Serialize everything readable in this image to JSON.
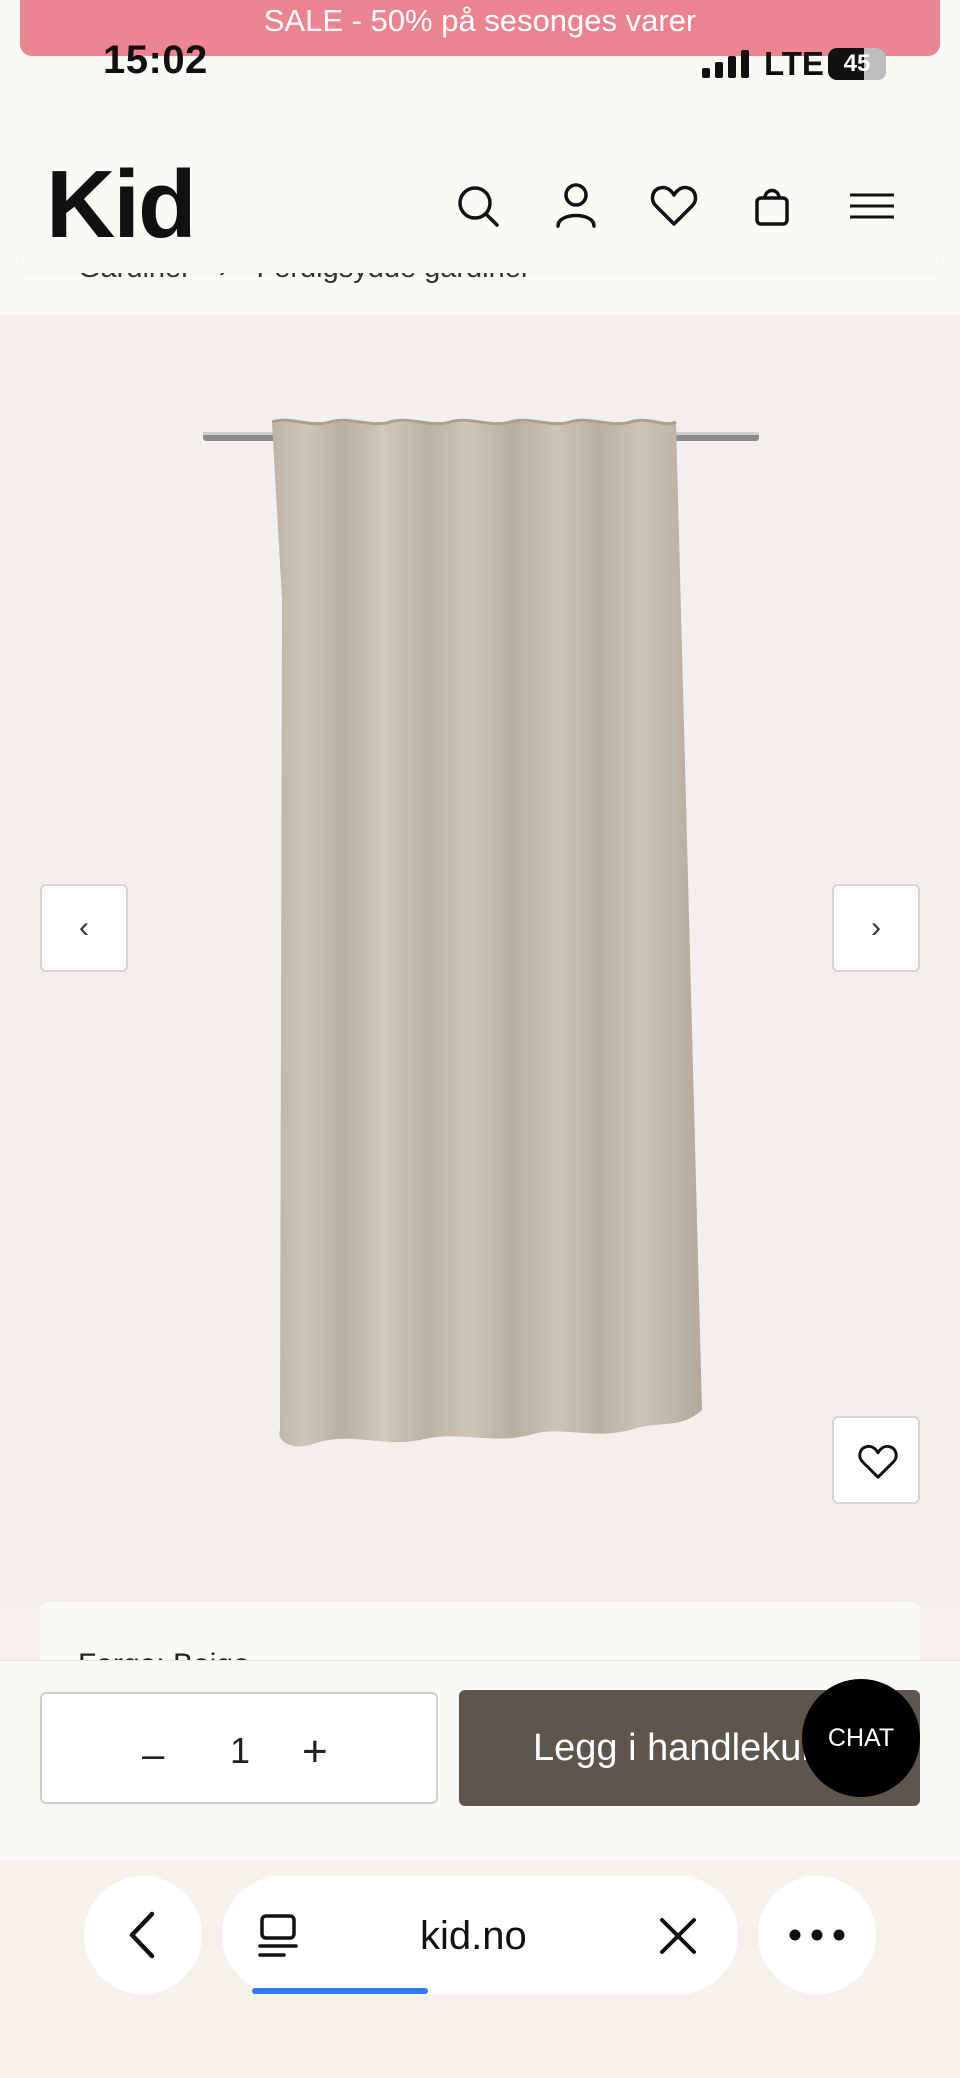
{
  "promo": {
    "text": "SALE - 50% på sesonges varer"
  },
  "status_bar": {
    "time": "15:02",
    "network": "LTE",
    "battery": "45"
  },
  "header": {
    "logo": "Kid",
    "icons": [
      "search-icon",
      "account-icon",
      "wishlist-icon",
      "cart-icon",
      "menu-icon"
    ]
  },
  "breadcrumb": {
    "items": [
      "Gardiner",
      "Ferdigsydde gardiner"
    ],
    "separator": "›"
  },
  "gallery": {
    "prev_label": "‹",
    "next_label": "›",
    "product_image": "curtain-image"
  },
  "info_card": {
    "label": "Farge: Beige"
  },
  "cart_bar": {
    "qty_minus": "–",
    "quantity": "1",
    "qty_plus": "+",
    "add_to_cart": "Legg i handlekurv",
    "chat": "CHAT"
  },
  "browser": {
    "url": "kid.no"
  },
  "colors": {
    "promo_bg": "#ec7d8c",
    "cta_bg": "#5e554d",
    "gallery_bg": "#f3f0eb",
    "progress": "#2b7cf6"
  }
}
